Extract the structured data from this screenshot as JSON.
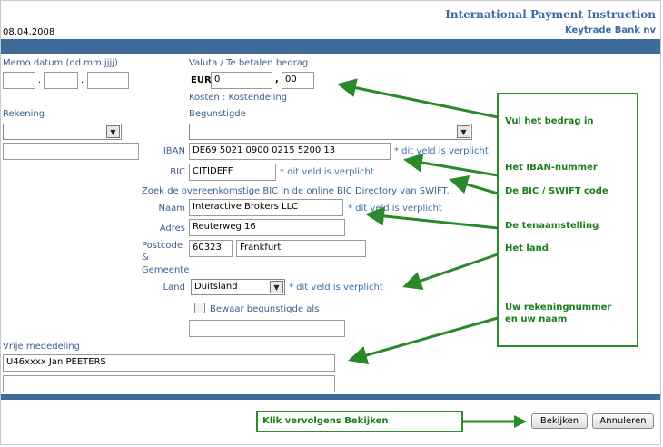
{
  "header": {
    "title": "International Payment Instruction",
    "date": "08.04.2008",
    "bank": "Keytrade Bank nv"
  },
  "form": {
    "memo_label": "Memo datum (dd.mm.jjjj)",
    "memo_sep1": ".",
    "memo_sep2": ".",
    "valuta_label": "Valuta / Te betalen bedrag",
    "currency": "EUR",
    "amount_int": "0",
    "amount_sep": ",",
    "amount_dec": "00",
    "kosten_label": "Kosten : Kostendeling",
    "rekening_label": "Rekening",
    "begunstigde_label": "Begunstigde",
    "iban_label": "IBAN",
    "iban_value": "DE69 5021 0900 0215 5200 13",
    "required_text": "* dit veld is verplicht",
    "bic_label": "BIC",
    "bic_value": "CITIDEFF",
    "bic_lookup_text": "Zoek de overeenkomstige BIC in de online BIC Directory van SWIFT.",
    "naam_label": "Naam",
    "naam_value": "Interactive Brokers LLC",
    "adres_label": "Adres",
    "adres_value": "Reuterweg 16",
    "postcode_label_1": "Postcode",
    "postcode_label_2": "&",
    "postcode_label_3": "Gemeente",
    "postcode_value": "60323",
    "gemeente_value": "Frankfurt",
    "land_label": "Land",
    "land_value": "Duitsland",
    "bewaar_label": "Bewaar begunstigde als",
    "mededeling_label": "Vrije mededeling",
    "mededeling_value": "U46xxxx  Jan PEETERS"
  },
  "annotations": {
    "bedrag": "Vul het bedrag in",
    "iban": "Het IBAN-nummer",
    "bic": "De BIC / SWIFT code",
    "tenaamstelling": "De tenaamstelling",
    "land": "Het land",
    "rekening_line1": "Uw rekeningnummer",
    "rekening_line2": "en uw naam",
    "klik": "Klik vervolgens Bekijken"
  },
  "buttons": {
    "bekijken": "Bekijken",
    "annuleren": "Annuleren"
  },
  "colors": {
    "bar": "#3d6a98",
    "label": "#3b5f8f",
    "annotation": "#1a7f1a"
  }
}
